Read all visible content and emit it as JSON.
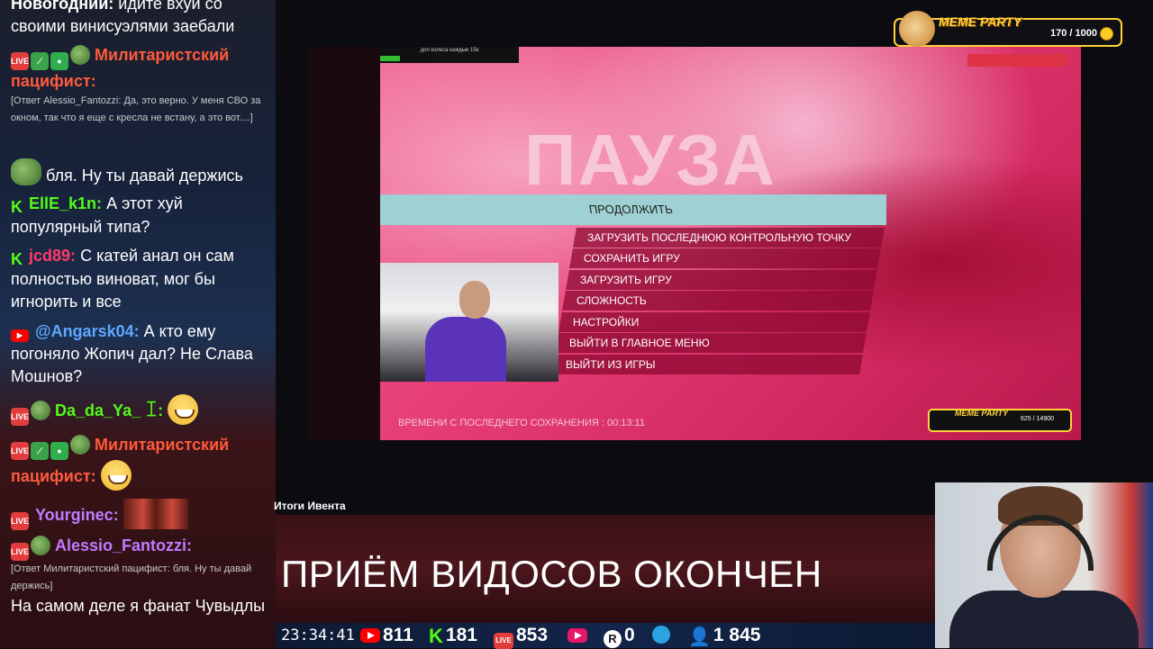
{
  "chat": {
    "messages": [
      {
        "name": "Новогодний:",
        "text": "идите вхуи со своими винисуэлями заебали"
      },
      {
        "name": "Милитаристский пацифист:",
        "reply": "[Ответ Alessio_Fantozzi: Да, это верно. У меня СВО за окном, так что я еще с кресла не встану, а это вот....]"
      },
      {
        "text": "бля. Ну ты давай держись"
      },
      {
        "name": "EllE_k1n:",
        "text": "А этот хуй популярный типа?"
      },
      {
        "name": "jcd89:",
        "text": "С катей анал он сам полностью виноват, мог бы игнорить и все"
      },
      {
        "name": "@Angarsk04:",
        "text": "А кто ему погоняло Жопич дал? Не Слава Мошнов?"
      },
      {
        "name": "Da_da_Ya_ ꀤ:"
      },
      {
        "name": "Милитаристский пацифист:"
      },
      {
        "name": "Yourginec:"
      },
      {
        "name": "Alessio_Fantozzi:",
        "reply": "[Ответ Милитаристский пацифист: бля. Ну ты давай держись]",
        "text": "На самом деле я фанат Чувыдлы"
      }
    ],
    "colors": {
      "red_name": "#ff5a3c",
      "green_name": "#53fc18",
      "blue_name": "#5fa8ff",
      "purple_name": "#c07bff"
    }
  },
  "game": {
    "hud_top": "доп колеса каждые 15к",
    "pause_title": "ПАУЗА",
    "menu": [
      "ПРОДОЛЖИТЬ",
      "ЗАГРУЗИТЬ ПОСЛЕДНЮЮ КОНТРОЛЬНУЮ ТОЧКУ",
      "СОХРАНИТЬ ИГРУ",
      "ЗАГРУЗИТЬ ИГРУ",
      "СЛОЖНОСТЬ",
      "НАСТРОЙКИ",
      "ВЫЙТИ В ГЛАВНОЕ МЕНЮ",
      "ВЫЙТИ ИЗ ИГРЫ"
    ],
    "save_time": "ВРЕМЕНИ С ПОСЛЕДНЕГО СОХРАНЕНИЯ : 00:13:11",
    "mini_meme_party": {
      "title": "MEME PARTY",
      "count": "625 / 14900"
    }
  },
  "meme_party": {
    "title": "MEME PARTY",
    "count": "170 / 1000"
  },
  "event_title": "Итоги Ивента",
  "banner_text": "ПРИЁМ ВИДОСОВ ОКОНЧЕН",
  "stats": {
    "clock": "23:34:41",
    "youtube": "811",
    "kick": "181",
    "live": "853",
    "rutube": "0",
    "total": "1 845"
  }
}
